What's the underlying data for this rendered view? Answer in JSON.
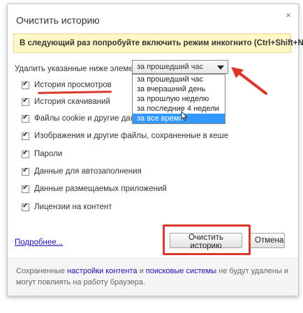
{
  "dialog": {
    "title": "Очистить историю",
    "close_glyph": "×",
    "banner": "В следующий раз попробуйте включить режим инкогнито (Ctrl+Shift+N).",
    "select_label": "Удалить указанные ниже элементы:",
    "select_value": "за прошедший час",
    "dropdown_options": [
      "за прошедший час",
      "за вчерашний день",
      "за прошлую неделю",
      "за последние 4 недели",
      "за все время"
    ],
    "dropdown_selected_index": 4,
    "checkboxes": [
      {
        "label": "История просмотров",
        "checked": true
      },
      {
        "label": "История скачиваний",
        "checked": true
      },
      {
        "label": "Файлы cookie и другие данные сайтов и плагинов",
        "checked": true
      },
      {
        "label": "Изображения и другие файлы, сохраненные в кеше",
        "checked": true
      },
      {
        "label": "Пароли",
        "checked": true
      },
      {
        "label": "Данные для автозаполнения",
        "checked": true
      },
      {
        "label": "Данные размещаемых приложений",
        "checked": true
      },
      {
        "label": "Лицензии на контент",
        "checked": true
      }
    ],
    "more_link": "Подробнее...",
    "clear_button": "Очистить историю",
    "cancel_button": "Отмена",
    "footer": {
      "part1": "Сохраненные ",
      "link1": "настройки контента",
      "part2": " и ",
      "link2": "поисковые системы",
      "part3": " не будут удалены и могут повлиять на работу браузера."
    }
  },
  "annotation_color": "#d9382b"
}
